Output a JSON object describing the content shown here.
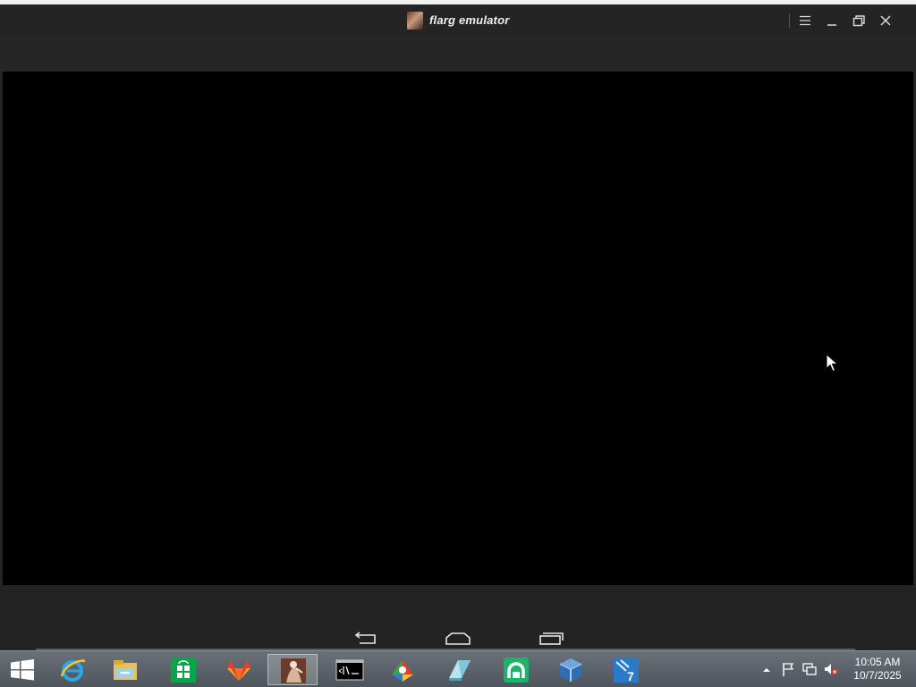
{
  "window": {
    "title": "flarg emulator",
    "app_icon": "flarg-app-icon",
    "controls": [
      "menu-icon",
      "minimize-icon",
      "restore-icon",
      "close-icon"
    ]
  },
  "screen": {
    "state": "blank",
    "background": "#000000"
  },
  "nav_bar": {
    "buttons": [
      "back-icon",
      "home-icon",
      "recents-icon"
    ]
  },
  "taskbar": {
    "pinned": [
      {
        "name": "internet-explorer-icon",
        "active": false
      },
      {
        "name": "file-explorer-icon",
        "active": false
      },
      {
        "name": "store-icon",
        "active": false
      },
      {
        "name": "gitlab-icon",
        "active": false
      },
      {
        "name": "flarg-emulator-icon",
        "active": true
      },
      {
        "name": "command-prompt-icon",
        "active": false
      },
      {
        "name": "paint-icon",
        "active": false
      },
      {
        "name": "eraser-icon",
        "active": false
      },
      {
        "name": "android-emulator-icon",
        "active": false
      },
      {
        "name": "virtualbox-icon",
        "active": false
      },
      {
        "name": "windows7-tools-icon",
        "active": false
      }
    ],
    "tray_icons": [
      "show-hidden-icons-icon",
      "action-center-flag-icon",
      "network-icon",
      "volume-muted-icon"
    ],
    "clock": {
      "time": "10:05 AM",
      "date": "10/7/2025"
    }
  },
  "colors": {
    "emulator_frame": "#242424",
    "screen": "#000000",
    "taskbar": "#5b6168",
    "text": "#f0f0f0"
  }
}
